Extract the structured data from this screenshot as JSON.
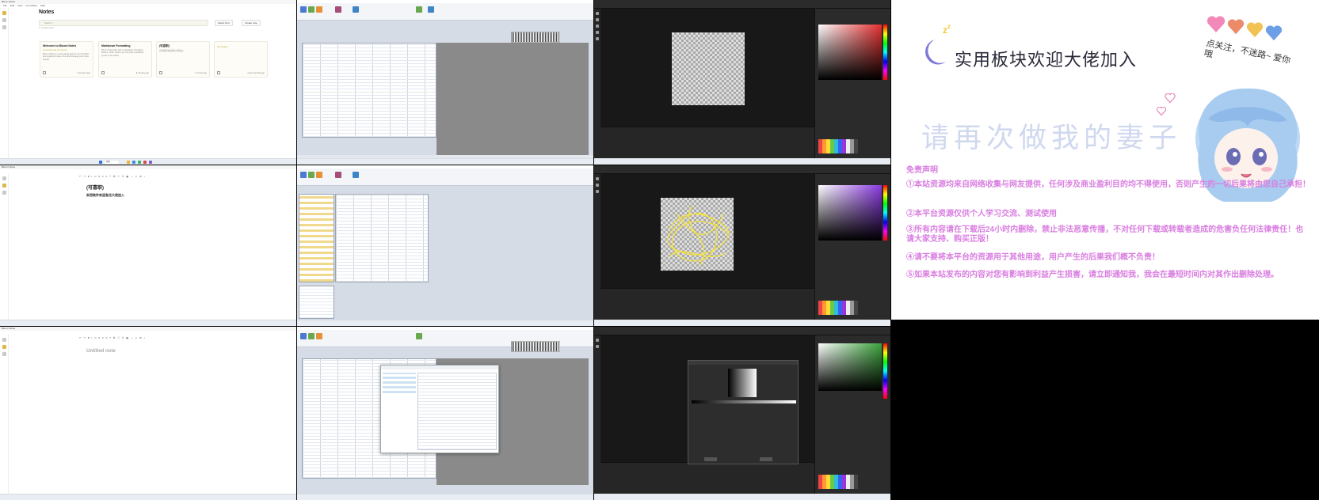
{
  "task_clock": "",
  "notes": {
    "window_title": "Bloom Notes",
    "menu": [
      "File",
      "Edit",
      "View",
      "Formatting",
      "Help"
    ],
    "page_title": "Notes",
    "search_placeholder": "Search...",
    "sort_label": "Select Sort",
    "create_label": "Create note",
    "note_count": "4 / 4 notes found",
    "cards": [
      {
        "title": "Welcome to Bloom Notes",
        "subtitle": "A tutorial note, 8 minutes",
        "body": "Bloom Notes is a note-taking app for your thoughts and organized notes. Find and manage your notes quickly.",
        "date": "8 minutes ago"
      },
      {
        "title": "Markdown Formatting",
        "subtitle": "",
        "body": "Bloom Notes also has a markdown formatting feature, which means you can write markdown syntax in the editor.",
        "date": "8 minutes ago"
      },
      {
        "title": "(可喜职)",
        "subtitle": "",
        "body": "实用软件欢迎各位大佬加入",
        "date": "1 minute ago"
      },
      {
        "title": "",
        "subtitle": "No content",
        "body": "",
        "date": "a few seconds ago"
      }
    ],
    "editor_title_1": "(可喜职)",
    "editor_line_1": "实用软件欢迎各位大佬加入",
    "editor_title_2": "Untitled note"
  },
  "promo": {
    "headline": "实用板块欢迎大佬加入",
    "watermark": "请再次做我的妻子",
    "side_note": "点关注，不迷路~ 爱你哦",
    "disclaimer_title": "免责声明",
    "disclaimer": [
      "①本站资源均来自网络收集与网友提供，任何涉及商业盈利目的均不得使用，否则产生的一切后果将由您自己承担！",
      "②本平台资源仅供个人学习交流、测试使用",
      "③所有内容请在下载后24小时内删除，禁止非法恶意传播，不对任何下载或转载者造成的危害负任何法律责任！也请大家支持、购买正版！",
      "④请不要将本平台的资源用于其他用途，用户产生的后果我们概不负责！",
      "⑤如果本站发布的内容对您有影响到利益产生损害，请立即通知我，我会在最短时间内对其作出删除处理。"
    ]
  },
  "colors": {
    "notes_accent": "#e0b64a",
    "promo_pink": "#d97ee0",
    "paint_bg": "#1f1f1f",
    "scribble": "#f3e23a"
  }
}
